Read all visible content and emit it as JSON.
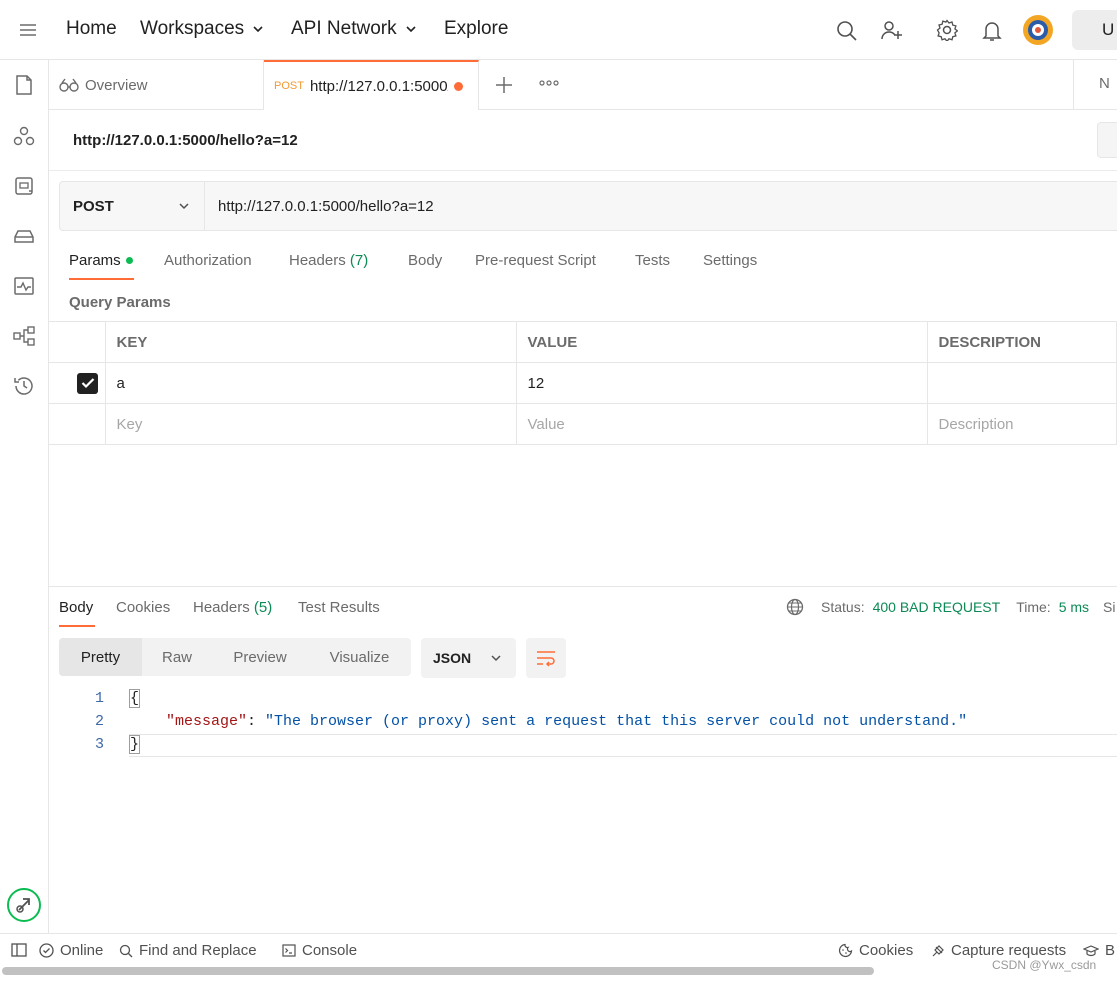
{
  "topbar": {
    "menu_icon": "hamburger-icon",
    "nav": [
      "Home",
      "Workspaces",
      "API Network",
      "Explore"
    ],
    "upgrade_label": "U"
  },
  "tabs": {
    "overview_label": "Overview",
    "request_method": "POST",
    "request_url": "http://127.0.0.1:5000/hello?a=12",
    "env_label": "N"
  },
  "request": {
    "title": "http://127.0.0.1:5000/hello?a=12",
    "method": "POST",
    "url": "http://127.0.0.1:5000/hello?a=12",
    "tabs": [
      {
        "label": "Params",
        "count": ""
      },
      {
        "label": "Authorization",
        "count": ""
      },
      {
        "label": "Headers",
        "count": "(7)"
      },
      {
        "label": "Body",
        "count": ""
      },
      {
        "label": "Pre-request Script",
        "count": ""
      },
      {
        "label": "Tests",
        "count": ""
      },
      {
        "label": "Settings",
        "count": ""
      }
    ],
    "query_params_label": "Query Params",
    "columns": [
      "KEY",
      "VALUE",
      "DESCRIPTION"
    ],
    "rows": [
      {
        "key": "a",
        "value": "12",
        "description": ""
      }
    ],
    "placeholders": {
      "key": "Key",
      "value": "Value",
      "description": "Description"
    }
  },
  "response": {
    "tabs": [
      {
        "label": "Body",
        "count": ""
      },
      {
        "label": "Cookies",
        "count": ""
      },
      {
        "label": "Headers",
        "count": "(5)"
      },
      {
        "label": "Test Results",
        "count": ""
      }
    ],
    "status_label": "Status:",
    "status_value": "400 BAD REQUEST",
    "time_label": "Time:",
    "time_value": "5 ms",
    "size_label": "Si",
    "views": [
      "Pretty",
      "Raw",
      "Preview",
      "Visualize"
    ],
    "format": "JSON",
    "code": {
      "line_numbers": [
        "1",
        "2",
        "3"
      ],
      "open_brace": "{",
      "key": "\"message\"",
      "colon": ": ",
      "value": "\"The browser (or proxy) sent a request that this server could not understand.\"",
      "close_brace": "}"
    }
  },
  "statusbar": {
    "online": "Online",
    "find_replace": "Find and Replace",
    "console": "Console",
    "cookies": "Cookies",
    "capture": "Capture requests",
    "bootcamp": "B"
  },
  "watermark": "CSDN @Ywx_csdn",
  "colors": {
    "accent": "#ff6c37",
    "success": "#0b8a55",
    "method_post": "#f29a33"
  }
}
